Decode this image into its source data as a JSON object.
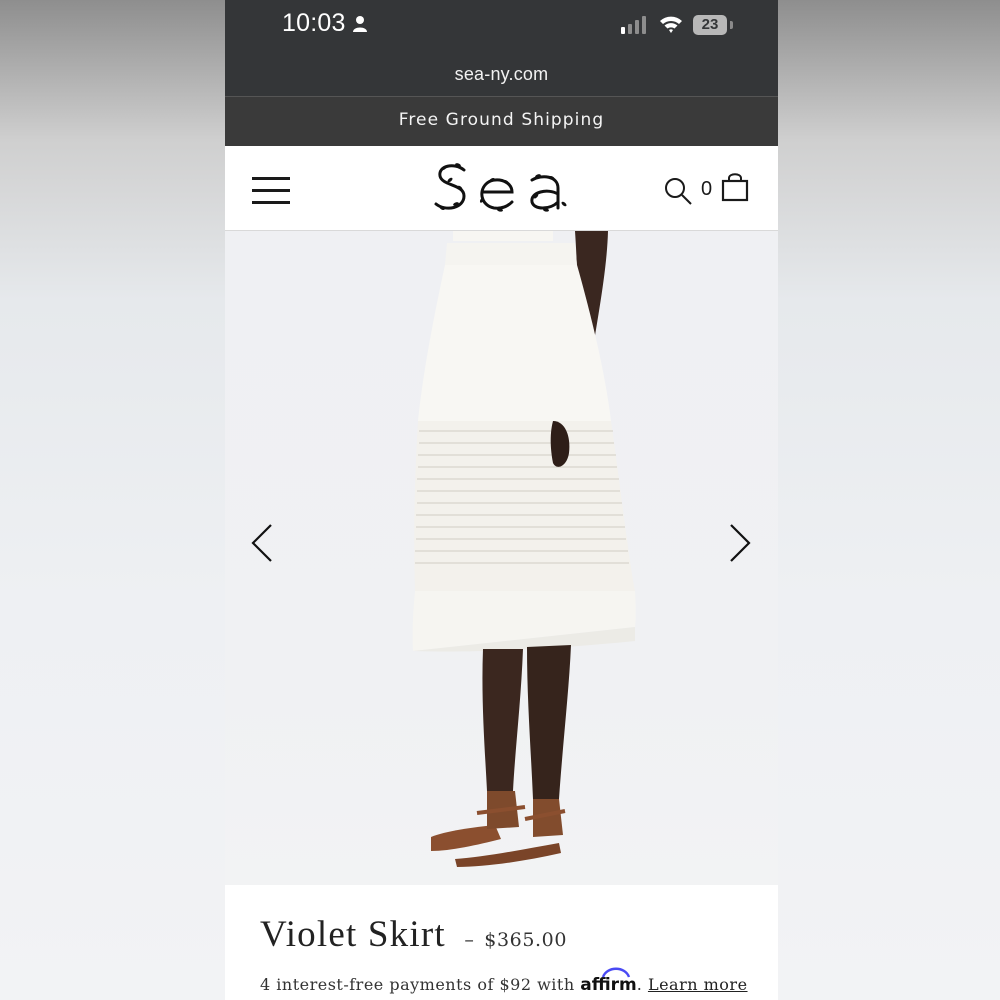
{
  "status_bar": {
    "time": "10:03",
    "battery_level": "23",
    "icons": [
      "person-icon",
      "signal-icon",
      "wifi-icon",
      "battery-icon"
    ]
  },
  "browser": {
    "url": "sea-ny.com"
  },
  "promo_banner": {
    "text": "Free Ground Shipping"
  },
  "header": {
    "cart_count": "0",
    "icons": [
      "menu-icon",
      "search-icon",
      "bag-icon"
    ]
  },
  "gallery": {
    "icons": [
      "chevron-left-icon",
      "chevron-right-icon"
    ]
  },
  "product": {
    "name": "Violet Skirt",
    "price_separator": "–",
    "price": "$365.00",
    "installments_prefix": "4 interest-free payments of $92 with ",
    "affirm_brand": "affirm",
    "installments_suffix": ". ",
    "learn_more": "Learn more"
  },
  "colors": {
    "status_bar_bg": "#343638",
    "promo_bg": "#3a3a3a",
    "text_dark": "#222222",
    "affirm_arc": "#4a4af4"
  }
}
